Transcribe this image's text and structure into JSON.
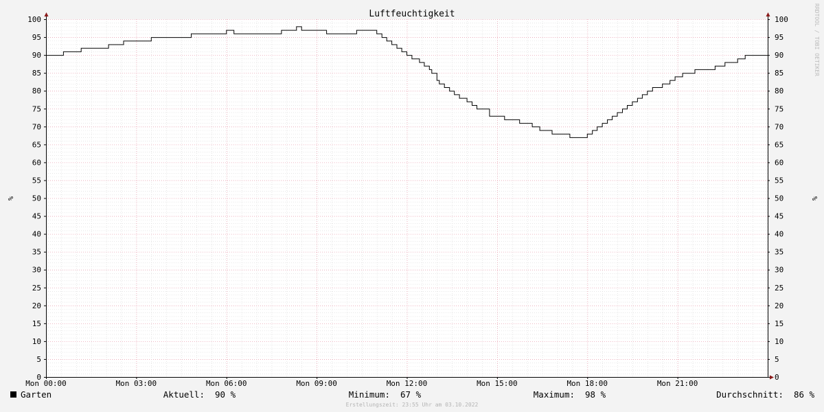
{
  "chart_data": {
    "type": "line",
    "title": "Luftfeuchtigkeit",
    "xlabel": "",
    "ylabel": "%",
    "ylabel_right": "%",
    "ylim": [
      0,
      100
    ],
    "y_ticks": [
      0,
      5,
      10,
      15,
      20,
      25,
      30,
      35,
      40,
      45,
      50,
      55,
      60,
      65,
      70,
      75,
      80,
      85,
      90,
      95,
      100
    ],
    "xlim_hours": [
      0,
      24
    ],
    "x_tick_hours": [
      0,
      3,
      6,
      9,
      12,
      15,
      18,
      21
    ],
    "x_tick_labels": [
      "Mon 00:00",
      "Mon 03:00",
      "Mon 06:00",
      "Mon 09:00",
      "Mon 12:00",
      "Mon 15:00",
      "Mon 18:00",
      "Mon 21:00"
    ],
    "grid": true,
    "series": [
      {
        "name": "Garten",
        "color": "#000000",
        "x_hours": [
          0,
          0.58,
          1.17,
          2.08,
          2.58,
          3.5,
          4.33,
          4.83,
          6.0,
          6.25,
          7.83,
          8.33,
          8.5,
          8.67,
          9.33,
          10.33,
          11.0,
          11.17,
          11.33,
          11.5,
          11.67,
          11.83,
          12.0,
          12.17,
          12.42,
          12.58,
          12.75,
          12.83,
          13.0,
          13.08,
          13.25,
          13.42,
          13.58,
          13.75,
          14.0,
          14.17,
          14.33,
          14.75,
          15.25,
          15.42,
          15.75,
          16.17,
          16.42,
          16.83,
          17.42,
          17.75,
          18.0,
          18.17,
          18.33,
          18.5,
          18.67,
          18.83,
          19.0,
          19.17,
          19.33,
          19.5,
          19.67,
          19.83,
          20.0,
          20.17,
          20.5,
          20.75,
          20.92,
          21.17,
          21.58,
          21.83,
          22.25,
          22.58,
          23.0,
          23.25,
          24.0
        ],
        "values": [
          90,
          91,
          92,
          93,
          94,
          95,
          95,
          96,
          97,
          96,
          97,
          98,
          97,
          97,
          96,
          97,
          96,
          95,
          94,
          93,
          92,
          91,
          90,
          89,
          88,
          87,
          86,
          85,
          83,
          82,
          81,
          80,
          79,
          78,
          77,
          76,
          75,
          73,
          72,
          72,
          71,
          70,
          69,
          68,
          67,
          67,
          68,
          69,
          70,
          71,
          72,
          73,
          74,
          75,
          76,
          77,
          78,
          79,
          80,
          81,
          82,
          83,
          84,
          85,
          86,
          86,
          87,
          88,
          89,
          90,
          90
        ]
      }
    ],
    "legend": {
      "placement": "bottom-left",
      "series_label": "Garten",
      "stats": [
        {
          "label": "Aktuell:",
          "value": "90 %"
        },
        {
          "label": "Minimum:",
          "value": "67 %"
        },
        {
          "label": "Maximum:",
          "value": "98 %"
        },
        {
          "label": "Durchschnitt:",
          "value": "86 %"
        }
      ]
    },
    "watermark": "RRDTOOL / TOBI OETIKER",
    "footnote": "Erstellungszeit: 23:55 Uhr am 03.10.2022"
  },
  "colors": {
    "background": "#f3f3f3",
    "canvas": "#ffffff",
    "grid_minor": "#d8d8d8",
    "grid_major": "#e8a0b0",
    "axis": "#000000",
    "arrow": "#8b1a1a",
    "line": "#000000"
  }
}
